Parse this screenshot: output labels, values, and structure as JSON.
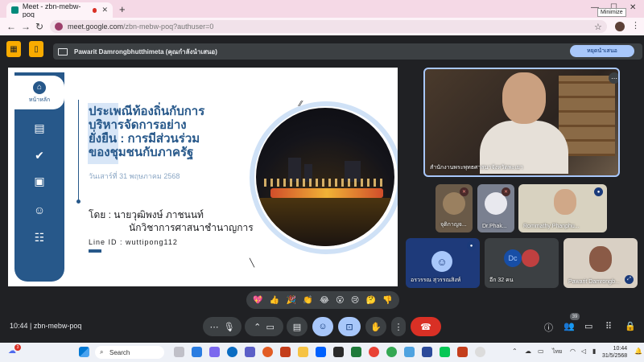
{
  "browser": {
    "tab_title": "Meet - zbn-mebw-poq",
    "url_host": "meet.google.com",
    "url_path": "/zbn-mebw-poq?authuser=0",
    "tooltip": "Minimize"
  },
  "meet": {
    "presenting_text": "Pawarit Damrongbhutthimeta (คุณกำลังนำเสนอ)",
    "stop_label": "หยุดนำเสนอ",
    "meeting_code": "zbn-mebw-poq",
    "time": "10:44",
    "people_count": "39"
  },
  "slide": {
    "home_label": "หน้าหลัก",
    "title_lines": [
      "ประเพณีท้องถิ่นกับการ",
      "บริหารจัดการอย่าง",
      "ยั่งยืน : การมีส่วนร่วม",
      "ของชุมชนกับภาครัฐ"
    ],
    "date": "วันเสาร์ที่ 31 พฤษภาคม 2568",
    "by_line": "โดย : นายวุฒิพงษ์ ภาชนนท์",
    "position": "นักวิชาการศาสนาชำนาญการ",
    "line_id": "Line ID : wuttipong112"
  },
  "tiles": {
    "main_label": "สำนักงานพระพุทธศาสนาจังหวัดพะเยา",
    "t1": "จุติกาญจ...",
    "t2": "Dr.Phak...",
    "t3": "Rommathy Phanphu...",
    "t4": "อรวรรณ สุวรรณสิงห์",
    "t5": "อีก 32 คน",
    "t5_avatar": "Dc",
    "t6": "Pawarit Damrongb..."
  },
  "reactions": [
    "💖",
    "👍",
    "🎉",
    "👏",
    "😂",
    "😮",
    "😢",
    "🤔",
    "👎"
  ],
  "taskbar": {
    "search": "Search",
    "lang": "ไทย",
    "clock_time": "10:44",
    "clock_date": "31/5/2568",
    "notif": "3"
  },
  "colors": {
    "accent": "#a8c7fa",
    "end_call": "#d93025",
    "slide_blue": "#27588a"
  }
}
